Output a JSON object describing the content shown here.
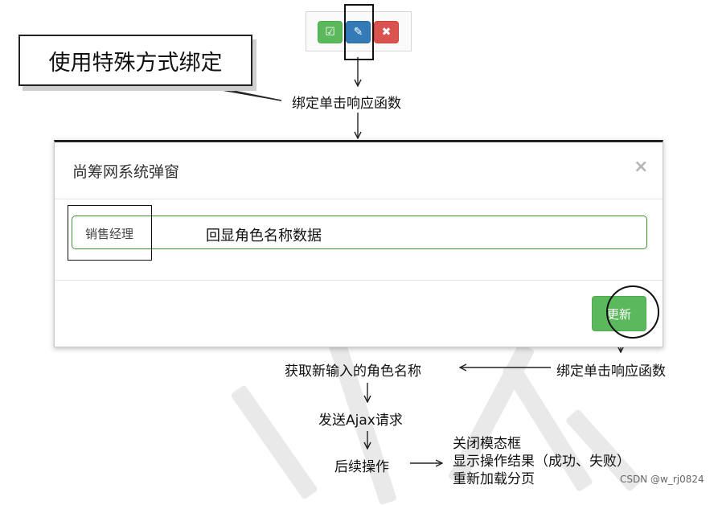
{
  "toolbar": {
    "buttons": [
      {
        "name": "confirm",
        "icon": "check-square-icon",
        "symbol": "☑",
        "color": "#5cb85c"
      },
      {
        "name": "edit",
        "icon": "pencil-icon",
        "symbol": "✎",
        "color": "#337ab7"
      },
      {
        "name": "delete",
        "icon": "close-icon",
        "symbol": "✖",
        "color": "#d9534f"
      }
    ]
  },
  "annotations": {
    "callout": "使用特殊方式绑定",
    "bind_click_top": "绑定单击响应函数",
    "bind_click_right": "绑定单击响应函数",
    "echo_role": "回显角色名称数据",
    "get_new_role": "获取新输入的角色名称",
    "send_ajax": "发送Ajax请求",
    "follow_up": "后续操作",
    "results": [
      "关闭模态框",
      "显示操作结果（成功、失败）",
      "重新加载分页"
    ]
  },
  "modal": {
    "title": "尚筹网系统弹窗",
    "close_symbol": "×",
    "role_name_value": "销售经理",
    "update_label": "更新"
  },
  "footer": {
    "credit": "CSDN @w_rj0824"
  }
}
